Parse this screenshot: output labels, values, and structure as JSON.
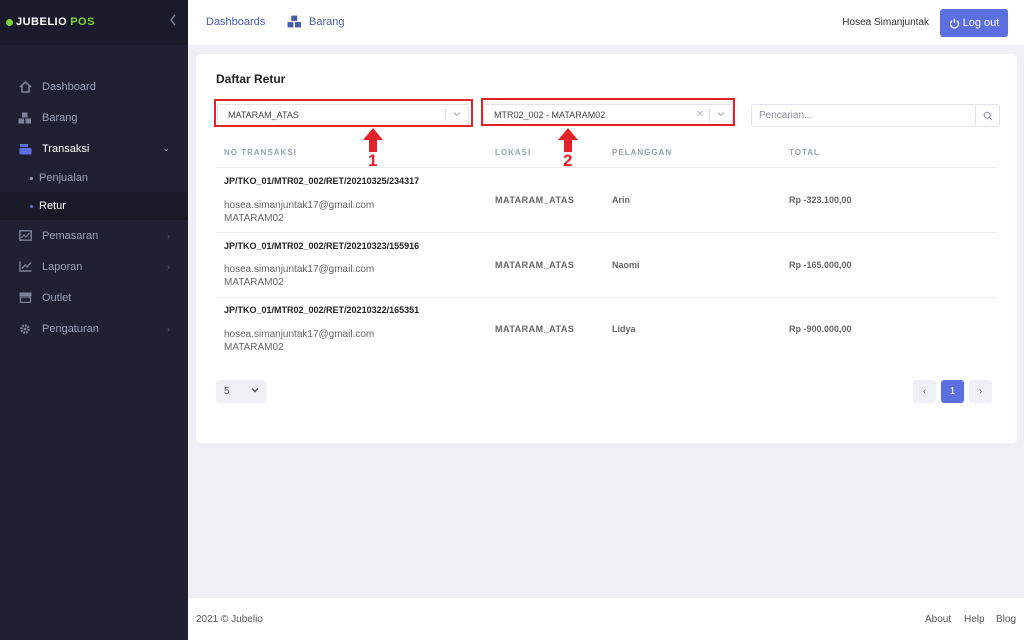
{
  "app": {
    "brand_main": "JUBELIO",
    "brand_accent": "POS",
    "accent_color": "#5b6fe0",
    "brand_color": "#7fd13b",
    "annotation_color": "#e2232a"
  },
  "sidebar": {
    "items": [
      {
        "label": "Dashboard",
        "icon": "home-icon"
      },
      {
        "label": "Barang",
        "icon": "cubes-icon"
      },
      {
        "label": "Transaksi",
        "icon": "cash-register-icon",
        "expanded": true
      },
      {
        "label": "Penjualan",
        "sub": true
      },
      {
        "label": "Retur",
        "sub": true,
        "active": true
      },
      {
        "label": "Pemasaran",
        "icon": "chart-image-icon"
      },
      {
        "label": "Laporan",
        "icon": "line-chart-icon"
      },
      {
        "label": "Outlet",
        "icon": "store-icon"
      },
      {
        "label": "Pengaturan",
        "icon": "gear-icon"
      }
    ]
  },
  "topbar": {
    "crumb_dashboards": "Dashboards",
    "crumb_barang": "Barang",
    "user": "Hosea Simanjuntak",
    "logout": "Log out"
  },
  "main": {
    "title": "Daftar Retur",
    "location_select": "MATARAM_ATAS",
    "register_select": "MTR02_002 - MATARAM02",
    "search_placeholder": "Pencarian...",
    "columns": [
      "NO TRANSAKSI",
      "LOKASI",
      "PELANGGAN",
      "TOTAL"
    ],
    "rows": [
      {
        "no": "JP/TKO_01/MTR02_002/RET/20210325/234317",
        "email": "hosea.simanjuntak17@gmail.com",
        "register": "MATARAM02",
        "lokasi": "MATARAM_ATAS",
        "pelanggan": "Arin",
        "total": "Rp -323.100,00"
      },
      {
        "no": "JP/TKO_01/MTR02_002/RET/20210323/155916",
        "email": "hosea.simanjuntak17@gmail.com",
        "register": "MATARAM02",
        "lokasi": "MATARAM_ATAS",
        "pelanggan": "Naomi",
        "total": "Rp -165.000,00"
      },
      {
        "no": "JP/TKO_01/MTR02_002/RET/20210322/165351",
        "email": "hosea.simanjuntak17@gmail.com",
        "register": "MATARAM02",
        "lokasi": "MATARAM_ATAS",
        "pelanggan": "Lidya",
        "total": "Rp -900.000,00"
      }
    ],
    "page_size": "5",
    "pager": {
      "prev": "‹",
      "current": "1",
      "next": "›"
    }
  },
  "annotations": {
    "one": "1",
    "two": "2"
  },
  "footer": {
    "copyright": "2021 © Jubelio",
    "about": "About",
    "help": "Help",
    "blog": "Blog"
  }
}
